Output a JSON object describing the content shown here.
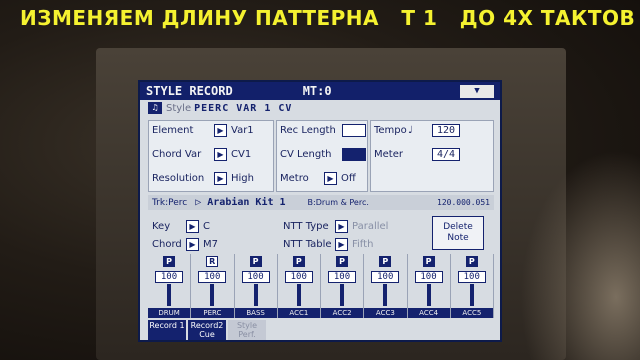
{
  "caption": "ИЗМЕНЯЕМ ДЛИНУ ПАТТЕРНА   Т 1   ДО 4Х ТАКТОВ",
  "title": "STYLE RECORD",
  "mt": "MT:0",
  "style_label": "Style",
  "style_value": "PEERC VAR 1 CV",
  "left_panel": {
    "element_label": "Element",
    "element_value": "Var1",
    "chord_var_label": "Chord Var",
    "chord_var_value": "CV1",
    "resolution_label": "Resolution",
    "resolution_value": "High"
  },
  "mid_panel": {
    "rec_length_label": "Rec Length",
    "cv_length_label": "CV Length",
    "metro_label": "Metro",
    "metro_value": "Off"
  },
  "right_panel": {
    "tempo_label": "Tempo",
    "tempo_value": "120",
    "meter_label": "Meter",
    "meter_value": "4/4"
  },
  "track_bar": {
    "track": "Trk:Perc",
    "kit": "Arabian Kit 1",
    "bank": "B:Drum & Perc.",
    "number": "120.000.051"
  },
  "key_row": {
    "key_label": "Key",
    "key_value": "C",
    "ntt_type_label": "NTT Type",
    "ntt_type_value": "Parallel"
  },
  "chord_row": {
    "chord_label": "Chord",
    "chord_value": "M7",
    "ntt_table_label": "NTT Table",
    "ntt_table_value": "Fifth"
  },
  "delete_note": "Delete Note",
  "channels": [
    {
      "badge": "P",
      "vol": "100",
      "label": "DRUM"
    },
    {
      "badge": "R",
      "vol": "100",
      "label": "PERC"
    },
    {
      "badge": "P",
      "vol": "100",
      "label": "BASS"
    },
    {
      "badge": "P",
      "vol": "100",
      "label": "ACC1"
    },
    {
      "badge": "P",
      "vol": "100",
      "label": "ACC2"
    },
    {
      "badge": "P",
      "vol": "100",
      "label": "ACC3"
    },
    {
      "badge": "P",
      "vol": "100",
      "label": "ACC4"
    },
    {
      "badge": "P",
      "vol": "100",
      "label": "ACC5"
    }
  ],
  "bottom_tabs": [
    "Record 1",
    "Record2 Cue",
    "Style Perf."
  ]
}
